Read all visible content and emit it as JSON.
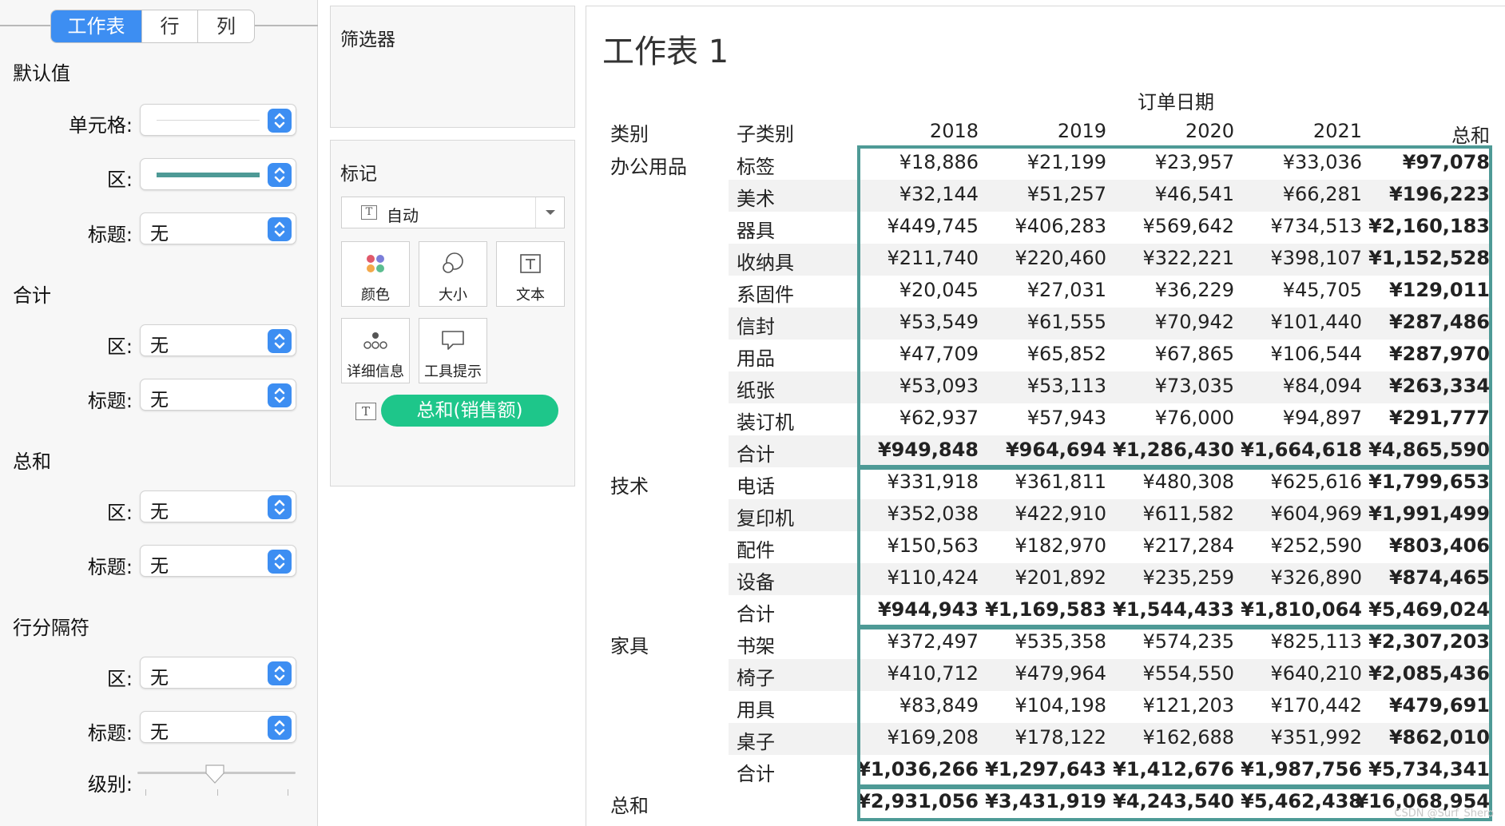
{
  "format_pane": {
    "tabs": [
      "工作表",
      "行",
      "列"
    ],
    "active_tab": "工作表",
    "sections": {
      "default": {
        "title": "默认值",
        "cell_label": "单元格:",
        "area_label": "区:",
        "header_label": "标题:",
        "header_value": "无"
      },
      "totals": {
        "title": "合计",
        "area_label": "区:",
        "area_value": "无",
        "header_label": "标题:",
        "header_value": "无"
      },
      "grand_totals": {
        "title": "总和",
        "area_label": "区:",
        "area_value": "无",
        "header_label": "标题:",
        "header_value": "无"
      },
      "row_divider": {
        "title": "行分隔符",
        "area_label": "区:",
        "area_value": "无",
        "header_label": "标题:",
        "header_value": "无",
        "level_label": "级别:"
      }
    },
    "colors": {
      "accent": "#3d8ef2",
      "line_color": "#4e9a96"
    }
  },
  "filters_card": {
    "title": "筛选器"
  },
  "marks_card": {
    "title": "标记",
    "mark_type": "自动",
    "buttons": [
      {
        "label": "颜色",
        "icon": "color-dots-icon"
      },
      {
        "label": "大小",
        "icon": "size-circles-icon"
      },
      {
        "label": "文本",
        "icon": "text-icon"
      },
      {
        "label": "详细信息",
        "icon": "detail-dots-icon"
      },
      {
        "label": "工具提示",
        "icon": "tooltip-icon"
      }
    ],
    "pill": "总和(销售额)",
    "pill_color": "#1ec68a"
  },
  "worksheet": {
    "title": "工作表 1",
    "column_group_header": "订单日期",
    "row_headers": [
      "类别",
      "子类别"
    ],
    "columns": [
      "2018",
      "2019",
      "2020",
      "2021",
      "总和"
    ],
    "categories": [
      {
        "name": "办公用品",
        "rows": [
          {
            "sub": "标签",
            "values": [
              "¥18,886",
              "¥21,199",
              "¥23,957",
              "¥33,036",
              "¥97,078"
            ]
          },
          {
            "sub": "美术",
            "values": [
              "¥32,144",
              "¥51,257",
              "¥46,541",
              "¥66,281",
              "¥196,223"
            ]
          },
          {
            "sub": "器具",
            "values": [
              "¥449,745",
              "¥406,283",
              "¥569,642",
              "¥734,513",
              "¥2,160,183"
            ]
          },
          {
            "sub": "收纳具",
            "values": [
              "¥211,740",
              "¥220,460",
              "¥322,221",
              "¥398,107",
              "¥1,152,528"
            ]
          },
          {
            "sub": "系固件",
            "values": [
              "¥20,045",
              "¥27,031",
              "¥36,229",
              "¥45,705",
              "¥129,011"
            ]
          },
          {
            "sub": "信封",
            "values": [
              "¥53,549",
              "¥61,555",
              "¥70,942",
              "¥101,440",
              "¥287,486"
            ]
          },
          {
            "sub": "用品",
            "values": [
              "¥47,709",
              "¥65,852",
              "¥67,865",
              "¥106,544",
              "¥287,970"
            ]
          },
          {
            "sub": "纸张",
            "values": [
              "¥53,093",
              "¥53,113",
              "¥73,035",
              "¥84,094",
              "¥263,334"
            ]
          },
          {
            "sub": "装订机",
            "values": [
              "¥62,937",
              "¥57,943",
              "¥76,000",
              "¥94,897",
              "¥291,777"
            ]
          }
        ],
        "subtotal": {
          "sub": "合计",
          "values": [
            "¥949,848",
            "¥964,694",
            "¥1,286,430",
            "¥1,664,618",
            "¥4,865,590"
          ]
        }
      },
      {
        "name": "技术",
        "rows": [
          {
            "sub": "电话",
            "values": [
              "¥331,918",
              "¥361,811",
              "¥480,308",
              "¥625,616",
              "¥1,799,653"
            ]
          },
          {
            "sub": "复印机",
            "values": [
              "¥352,038",
              "¥422,910",
              "¥611,582",
              "¥604,969",
              "¥1,991,499"
            ]
          },
          {
            "sub": "配件",
            "values": [
              "¥150,563",
              "¥182,970",
              "¥217,284",
              "¥252,590",
              "¥803,406"
            ]
          },
          {
            "sub": "设备",
            "values": [
              "¥110,424",
              "¥201,892",
              "¥235,259",
              "¥326,890",
              "¥874,465"
            ]
          }
        ],
        "subtotal": {
          "sub": "合计",
          "values": [
            "¥944,943",
            "¥1,169,583",
            "¥1,544,433",
            "¥1,810,064",
            "¥5,469,024"
          ]
        }
      },
      {
        "name": "家具",
        "rows": [
          {
            "sub": "书架",
            "values": [
              "¥372,497",
              "¥535,358",
              "¥574,235",
              "¥825,113",
              "¥2,307,203"
            ]
          },
          {
            "sub": "椅子",
            "values": [
              "¥410,712",
              "¥479,964",
              "¥554,550",
              "¥640,210",
              "¥2,085,436"
            ]
          },
          {
            "sub": "用具",
            "values": [
              "¥83,849",
              "¥104,198",
              "¥121,203",
              "¥170,442",
              "¥479,691"
            ]
          },
          {
            "sub": "桌子",
            "values": [
              "¥169,208",
              "¥178,122",
              "¥162,688",
              "¥351,992",
              "¥862,010"
            ]
          }
        ],
        "subtotal": {
          "sub": "合计",
          "values": [
            "¥1,036,266",
            "¥1,297,643",
            "¥1,412,676",
            "¥1,987,756",
            "¥5,734,341"
          ]
        }
      }
    ],
    "grand_total": {
      "label": "总和",
      "values": [
        "¥2,931,056",
        "¥3,431,919",
        "¥4,243,540",
        "¥5,462,438",
        "¥16,068,954"
      ]
    },
    "watermark": "CSDN @Surf_Shero"
  }
}
